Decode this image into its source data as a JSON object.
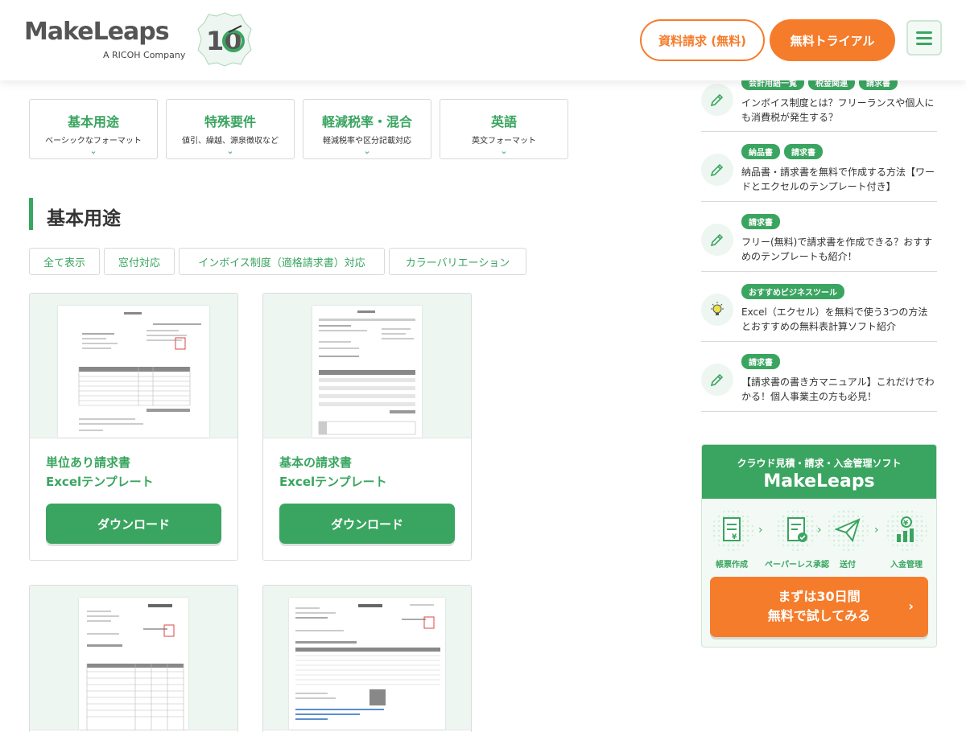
{
  "header": {
    "logo_text": "MakeLeaps",
    "logo_sub": "A RICOH Company",
    "anniversary": "10",
    "request_docs_label": "資料請求 (無料)",
    "free_trial_label": "無料トライアル"
  },
  "categories": [
    {
      "title": "基本用途",
      "sub": "ベーシックなフォーマット"
    },
    {
      "title": "特殊要件",
      "sub": "値引、繰越、源泉徴収など"
    },
    {
      "title": "軽減税率・混合",
      "sub": "軽減税率や区分記載対応"
    },
    {
      "title": "英語",
      "sub": "英文フォーマット"
    }
  ],
  "section": {
    "title": "基本用途"
  },
  "filters": [
    "全て表示",
    "窓付対応",
    "インボイス制度（適格請求書）対応",
    "カラーバリエーション"
  ],
  "templates": [
    {
      "name_line1": "単位あり請求書",
      "name_line2": "Excelテンプレート",
      "download_label": "ダウンロード"
    },
    {
      "name_line1": "基本の請求書",
      "name_line2": "Excelテンプレート",
      "download_label": "ダウンロード"
    }
  ],
  "sidebar": {
    "articles": [
      {
        "tags": [
          "会計用語一覧",
          "税金関連",
          "請求書"
        ],
        "text": "インボイス制度とは？フリーランスや個人にも消費税が発生する？",
        "icon": "pencil-icon"
      },
      {
        "tags": [
          "納品書",
          "請求書"
        ],
        "text": "納品書・請求書を無料で作成する方法【ワードとエクセルのテンプレート付き】",
        "icon": "pencil-icon"
      },
      {
        "tags": [
          "請求書"
        ],
        "text": "フリー(無料)で請求書を作成できる？おすすめのテンプレートも紹介！",
        "icon": "pencil-icon"
      },
      {
        "tags": [
          "おすすめビジネスツール"
        ],
        "text": "Excel（エクセル）を無料で使う3つの方法とおすすめの無料表計算ソフト紹介",
        "icon": "lightbulb-icon"
      },
      {
        "tags": [
          "請求書"
        ],
        "text": "【請求書の書き方マニュアル】これだけでわかる！個人事業主の方も必見！",
        "icon": "pencil-icon"
      }
    ],
    "promo": {
      "subtitle": "クラウド見積・請求・入金管理ソフト",
      "name": "MakeLeaps",
      "steps": [
        "帳票作成",
        "ペーパーレス承認",
        "送付",
        "入金管理"
      ],
      "cta_line1": "まずは30日間",
      "cta_line2": "無料で試してみる"
    }
  },
  "colors": {
    "brand_green": "#3aa560",
    "accent_orange": "#f57c2b"
  }
}
